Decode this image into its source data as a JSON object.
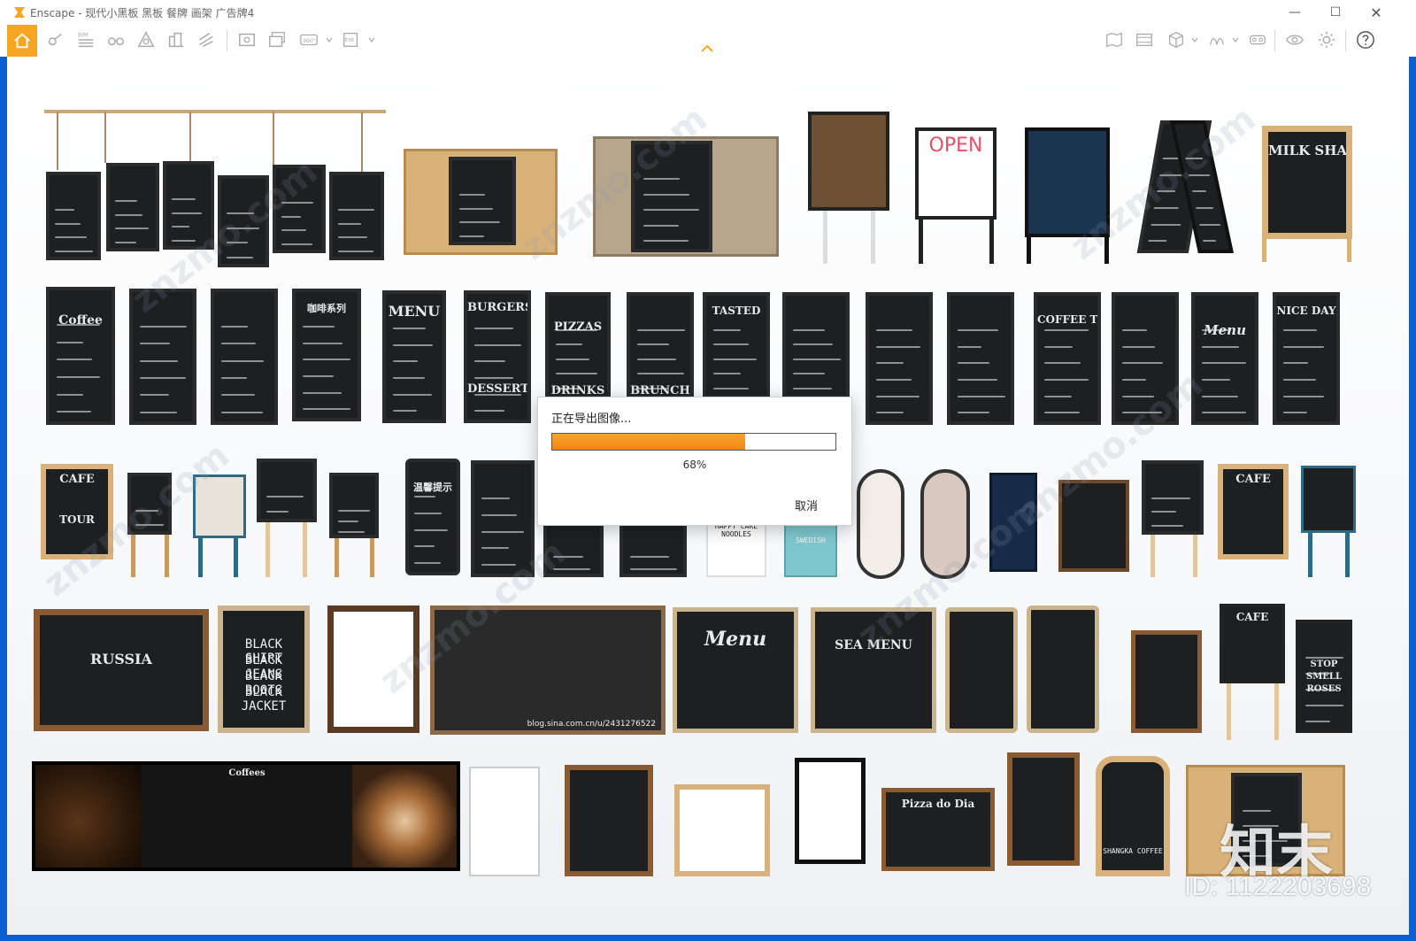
{
  "window": {
    "title": "Enscape - 现代小黑板 黑板 餐牌 画架 广告牌4",
    "accent_color": "#f5a623",
    "frame_color": "#0a5fd0"
  },
  "toolbar": {
    "left_icons": [
      "home-icon",
      "bim-tags-icon",
      "bim-list-icon",
      "binoculars-icon",
      "asset-library-icon",
      "buildings-icon",
      "materials-icon",
      "screenshot-icon",
      "batch-render-icon",
      "panorama-icon",
      "exe-export-icon"
    ],
    "right_icons": [
      "map-icon",
      "video-editor-icon",
      "cube-view-icon",
      "atmosphere-icon",
      "vr-headset-icon",
      "visual-settings-icon",
      "settings-icon",
      "help-icon"
    ],
    "bim_label": "BIM",
    "panorama_label": "360°",
    "exe_label": "EXE"
  },
  "dialog": {
    "title": "正在导出图像...",
    "progress": 0.68,
    "percent_text": "68%",
    "cancel_label": "取消"
  },
  "signs": {
    "open": "OPEN",
    "milk_shake": "MILK SHAKE",
    "coffee": "Coffee",
    "menu": "MENU",
    "burgers": "BURGERS",
    "pizzas": "PIZZAS",
    "desserts": "DESSERTS",
    "drinks": "DRINKS",
    "brunch": "BRUNCH",
    "tasted": "TASTED",
    "coffee_time": "COFFEE TIME",
    "nice_day": "NICE DAY",
    "cafe": "CAFE",
    "black_shirt": "BLACK SHIRT",
    "black_jeans": "BLACK JEANS",
    "black_boots": "BLACK BOOTS",
    "black_jacket": "BLACK JACKET",
    "russia": "RUSSIA",
    "seamenu": "SEA MENU",
    "menu_script": "Menu",
    "pizza_do_dia": "Pizza do Dia",
    "shangka": "SHANGKA COFFEE",
    "blog": "blog.sina.com.cn/u/2431276522",
    "stop_smell": "STOP SMELL ROSES",
    "tour": "TOUR",
    "coffees": "Coffees",
    "hot_drinks": "咖啡系列",
    "wenxin": "温馨提示",
    "swedish": "SWEDISH",
    "noodles": "HAPPY CAKE NOODLES"
  },
  "watermarks": {
    "site": "znzmo.com",
    "logo": "知末",
    "id": "ID: 1122203698"
  }
}
